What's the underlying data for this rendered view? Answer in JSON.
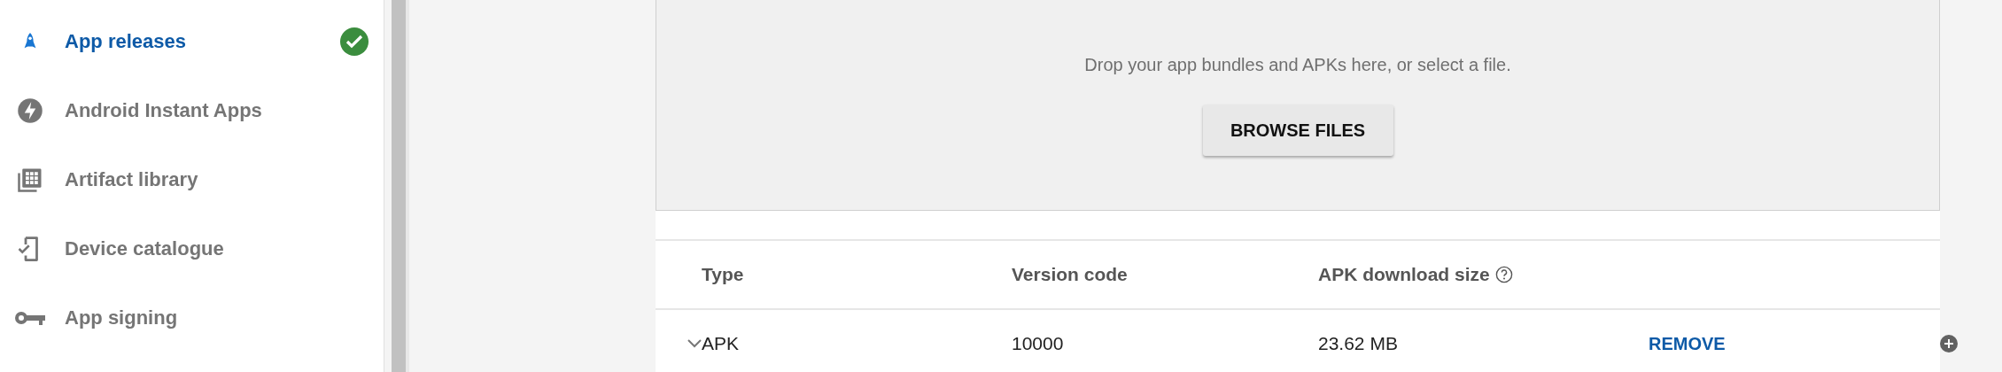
{
  "sidebar": {
    "items": [
      {
        "label": "App releases",
        "selected": true,
        "completed": true
      },
      {
        "label": "Android Instant Apps",
        "selected": false,
        "completed": false
      },
      {
        "label": "Artifact library",
        "selected": false,
        "completed": false
      },
      {
        "label": "Device catalogue",
        "selected": false,
        "completed": false
      },
      {
        "label": "App signing",
        "selected": false,
        "completed": false
      }
    ]
  },
  "upload": {
    "message": "Drop your app bundles and APKs here, or select a file.",
    "button": "BROWSE FILES"
  },
  "table": {
    "columns": [
      "Type",
      "Version code",
      "APK download size"
    ],
    "rows": [
      {
        "expanded": false,
        "type": "APK",
        "version_code": "10000",
        "size": "23.62 MB",
        "action": "REMOVE"
      }
    ]
  }
}
